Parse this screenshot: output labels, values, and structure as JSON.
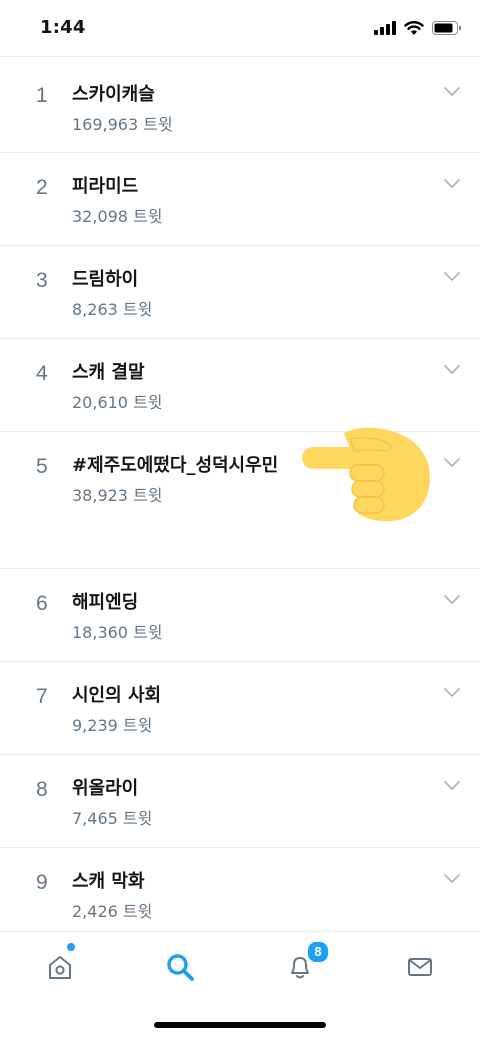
{
  "status_bar": {
    "time": "1:44"
  },
  "trends": [
    {
      "rank": "1",
      "name": "스카이캐슬",
      "count": "169,963 트윗"
    },
    {
      "rank": "2",
      "name": "피라미드",
      "count": "32,098 트윗"
    },
    {
      "rank": "3",
      "name": "드림하이",
      "count": "8,263 트윗"
    },
    {
      "rank": "4",
      "name": "스캐 결말",
      "count": "20,610 트윗"
    },
    {
      "rank": "5",
      "name": "#제주도에떴다_성덕시우민",
      "count": "38,923 트윗"
    },
    {
      "rank": "6",
      "name": "해피엔딩",
      "count": "18,360 트윗"
    },
    {
      "rank": "7",
      "name": "시인의 사회",
      "count": "9,239 트윗"
    },
    {
      "rank": "8",
      "name": "위올라이",
      "count": "7,465 트윗"
    },
    {
      "rank": "9",
      "name": "스캐 막화",
      "count": "2,426 트윗"
    }
  ],
  "tab_bar": {
    "notifications_badge": "8",
    "active_tab": "search",
    "icons": [
      "home-icon",
      "search-icon",
      "bell-icon",
      "mail-icon"
    ]
  },
  "colors": {
    "accent": "#1da1f2",
    "secondary_text": "#657786",
    "divider": "#e6ecf0",
    "pointer_emoji": "#ffd75e"
  }
}
